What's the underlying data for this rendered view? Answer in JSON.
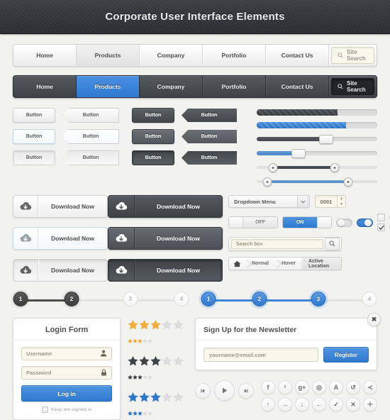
{
  "header": {
    "title": "Corporate User Interface Elements"
  },
  "nav_light": {
    "items": [
      {
        "label": "Home",
        "state": "normal"
      },
      {
        "label": "Products",
        "state": "active"
      },
      {
        "label": "Company",
        "state": "normal"
      },
      {
        "label": "Portfolio",
        "state": "normal"
      },
      {
        "label": "Contact Us",
        "state": "normal"
      }
    ],
    "search_placeholder": "Site Search",
    "search_icon": "search-icon"
  },
  "nav_dark": {
    "items": [
      {
        "label": "Home",
        "state": "normal"
      },
      {
        "label": "Products",
        "state": "active"
      },
      {
        "label": "Company",
        "state": "normal"
      },
      {
        "label": "Portfolio",
        "state": "normal"
      },
      {
        "label": "Contact Us",
        "state": "normal"
      }
    ],
    "search_placeholder": "Site Search",
    "search_icon": "search-icon"
  },
  "buttons": {
    "label": "Button",
    "light": [
      {
        "state": "normal"
      },
      {
        "state": "hover"
      },
      {
        "state": "active"
      }
    ],
    "dark": [
      {
        "state": "normal"
      },
      {
        "state": "hover"
      },
      {
        "state": "active"
      }
    ]
  },
  "progress": [
    {
      "name": "progress-dark",
      "value": 67,
      "style": "striped-dark"
    },
    {
      "name": "progress-blue",
      "value": 74,
      "style": "striped-blue"
    }
  ],
  "sliders": [
    {
      "name": "slider-dark",
      "value": 57,
      "style": "dark"
    },
    {
      "name": "slider-blue",
      "value": 34,
      "style": "blue"
    }
  ],
  "ranges": [
    {
      "name": "range-dark",
      "from": 13,
      "to": 64,
      "style": "dark"
    },
    {
      "name": "range-blue",
      "from": 8,
      "to": 75,
      "style": "blue"
    }
  ],
  "downloads": {
    "label": "Download Now",
    "icon": "cloud-download-icon",
    "light": [
      {
        "state": "normal"
      },
      {
        "state": "hover"
      },
      {
        "state": "active"
      }
    ],
    "dark": [
      {
        "state": "normal"
      },
      {
        "state": "hover"
      },
      {
        "state": "active"
      }
    ]
  },
  "form_controls": {
    "dropdown": {
      "label": "Dropdown Menu",
      "arrow_icon": "chevron-down-icon"
    },
    "stepper": {
      "value": "0001",
      "up_icon": "caret-up-icon",
      "down_icon": "caret-down-icon"
    },
    "toggle_off": {
      "label": "OFF"
    },
    "toggle_on": {
      "label": "ON"
    },
    "pill_off": {
      "state": "off"
    },
    "pill_on": {
      "state": "on"
    },
    "checkbox_unchecked": {
      "icon": "checkbox-icon"
    },
    "checkbox_checked": {
      "icon": "check-icon"
    },
    "radio_unselected": {
      "icon": "radio-icon"
    },
    "radio_selected": {
      "icon": "radio-selected-icon"
    },
    "searchbox": {
      "placeholder": "Search box",
      "button_icon": "search-icon"
    },
    "breadcrumb": {
      "home_icon": "home-icon",
      "segments": [
        {
          "label": "Normal",
          "state": "normal"
        },
        {
          "label": "Hover",
          "state": "hover"
        },
        {
          "label": "Active Location",
          "state": "active"
        }
      ]
    }
  },
  "steps": {
    "dark": {
      "labels": [
        "1",
        "2",
        "3",
        "4"
      ],
      "completed_index": 1,
      "style": "dark"
    },
    "blue": {
      "labels": [
        "1",
        "2",
        "3",
        "4"
      ],
      "completed_index": 2,
      "style": "blue"
    }
  },
  "login_form": {
    "title": "Login Form",
    "username": {
      "placeholder": "Username",
      "icon": "user-icon"
    },
    "password": {
      "placeholder": "Password",
      "icon": "lock-icon"
    },
    "submit_label": "Log in",
    "keep_signed_in_label": "Keep me signed in",
    "keep_signed_in_checked": false
  },
  "ratings": [
    {
      "name": "rating-gold",
      "filled": 3,
      "total": 5,
      "color": "#f0ad3c"
    },
    {
      "name": "rating-dark",
      "filled": 3,
      "total": 5,
      "color": "#3f4347"
    },
    {
      "name": "rating-blue",
      "filled": 3,
      "total": 5,
      "color": "#3079c8"
    }
  ],
  "newsletter": {
    "title": "Sign Up for the Newsletter",
    "email_placeholder": "yourname@email.com",
    "button_label": "Register",
    "close_label": "✖",
    "close_icon": "close-icon"
  },
  "media_player": {
    "prev_icon": "previous-icon",
    "play_icon": "play-icon",
    "next_icon": "next-icon"
  },
  "social_icons": {
    "row1": [
      {
        "icon": "facebook-icon",
        "glyph": "f"
      },
      {
        "icon": "twitter-icon",
        "glyph": "ᵗ"
      },
      {
        "icon": "google-plus-icon",
        "glyph": "g+"
      },
      {
        "icon": "camera-icon",
        "glyph": "◎"
      },
      {
        "icon": "triangle-a-icon",
        "glyph": "A"
      },
      {
        "icon": "refresh-icon",
        "glyph": "↺"
      },
      {
        "icon": "share-icon",
        "glyph": "≺"
      }
    ],
    "row2": [
      {
        "icon": "arrow-up-icon",
        "glyph": "↑"
      },
      {
        "icon": "arrow-right-icon",
        "glyph": "→"
      },
      {
        "icon": "arrow-down-icon",
        "glyph": "↓"
      },
      {
        "icon": "arrow-left-icon",
        "glyph": "←"
      },
      {
        "icon": "check-icon",
        "glyph": "✓"
      },
      {
        "icon": "close-icon",
        "glyph": "✕"
      },
      {
        "icon": "plus-icon",
        "glyph": "＋"
      }
    ]
  },
  "colors": {
    "accent_blue": "#3079c8",
    "dark": "#3d4146",
    "gold": "#f0ad3c",
    "page_bg": "#f2f2f0",
    "field_bg": "#faf8ec"
  }
}
